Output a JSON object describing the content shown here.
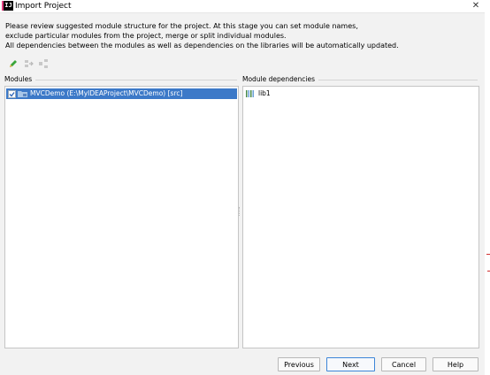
{
  "window": {
    "title": "Import Project",
    "close_glyph": "✕",
    "app_icon_text": "IJ"
  },
  "description": {
    "line1": "Please review suggested module structure for the project. At this stage you can set module names,",
    "line2": "exclude particular modules from the project, merge or split individual modules.",
    "line3": "All dependencies between the modules as well as dependencies on the libraries will be automatically updated."
  },
  "toolbar": {
    "rename_icon": "pencil-icon",
    "merge_icon": "merge-modules-icon",
    "split_icon": "split-module-icon"
  },
  "modules": {
    "label": "Modules",
    "items": [
      {
        "name": "MVCDemo (E:\\MyIDEAProject\\MVCDemo) [src]",
        "checked": true,
        "selected": true
      }
    ]
  },
  "dependencies": {
    "label": "Module dependencies",
    "items": [
      {
        "name": "lib1",
        "icon": "library-icon"
      }
    ]
  },
  "buttons": {
    "previous": "Previous",
    "next": "Next",
    "cancel": "Cancel",
    "help": "Help"
  },
  "colors": {
    "selection": "#3c79c8",
    "dialog_bg": "#f2f2f2",
    "default_button_border": "#3d86d8"
  }
}
